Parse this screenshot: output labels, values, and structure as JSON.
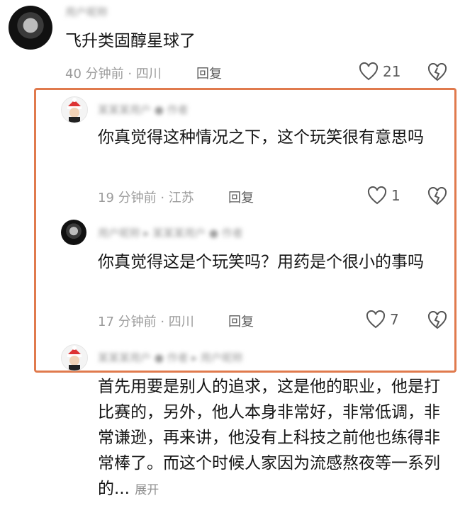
{
  "main_comment": {
    "username_blurred": "用户昵称",
    "text": "飞升类固醇星球了",
    "time_location": "40 分钟前 · 四川",
    "reply_label": "回复",
    "likes": "21"
  },
  "replies": [
    {
      "username_blurred": "某某某用户 ● 作者",
      "text": "你真觉得这种情况之下，这个玩笑很有意思吗",
      "time_location": "19 分钟前 · 江苏",
      "reply_label": "回复",
      "likes": "1"
    },
    {
      "username_blurred": "用户昵称 ▸ 某某某用户 ● 作者",
      "text": "你真觉得这是个玩笑吗？用药是个很小的事吗",
      "time_location": "17 分钟前 · 四川",
      "reply_label": "回复",
      "likes": "7"
    },
    {
      "username_blurred": "某某某用户 ● 作者 ▸ 用户昵称",
      "text": "首先用要是别人的追求，这是他的职业，他是打比赛的，另外，他人本身非常好，非常低调，非常谦逊，再来讲，他没有上科技之前他也练得非常棒了。而这个时候人家因为流感熬夜等一系列的...",
      "expand_label": "展开"
    }
  ],
  "colors": {
    "highlight": "#e07a4d",
    "meta": "#9b9b9b"
  }
}
